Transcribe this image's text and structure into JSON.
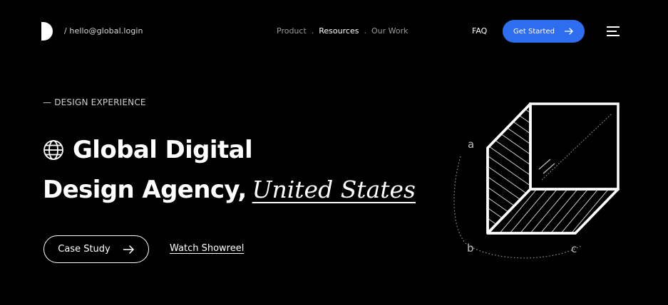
{
  "header": {
    "email": "/ hello@global.login",
    "nav": {
      "product": "Product",
      "resources": "Resources",
      "our_work": "Our Work",
      "separator": "."
    },
    "faq": "FAQ",
    "cta_label": "Get Started"
  },
  "hero": {
    "eyebrow": "— DESIGN EXPERIENCE",
    "title_line1": "Global Digital",
    "title_line2": "Design Agency,",
    "title_emphasis": "United States",
    "primary_button": "Case Study",
    "secondary_link": "Watch Showreel"
  },
  "illustration": {
    "label_a": "a",
    "label_b": "b",
    "label_c": "c"
  },
  "colors": {
    "background": "#000000",
    "accent": "#2f6df0",
    "text": "#ffffff"
  }
}
